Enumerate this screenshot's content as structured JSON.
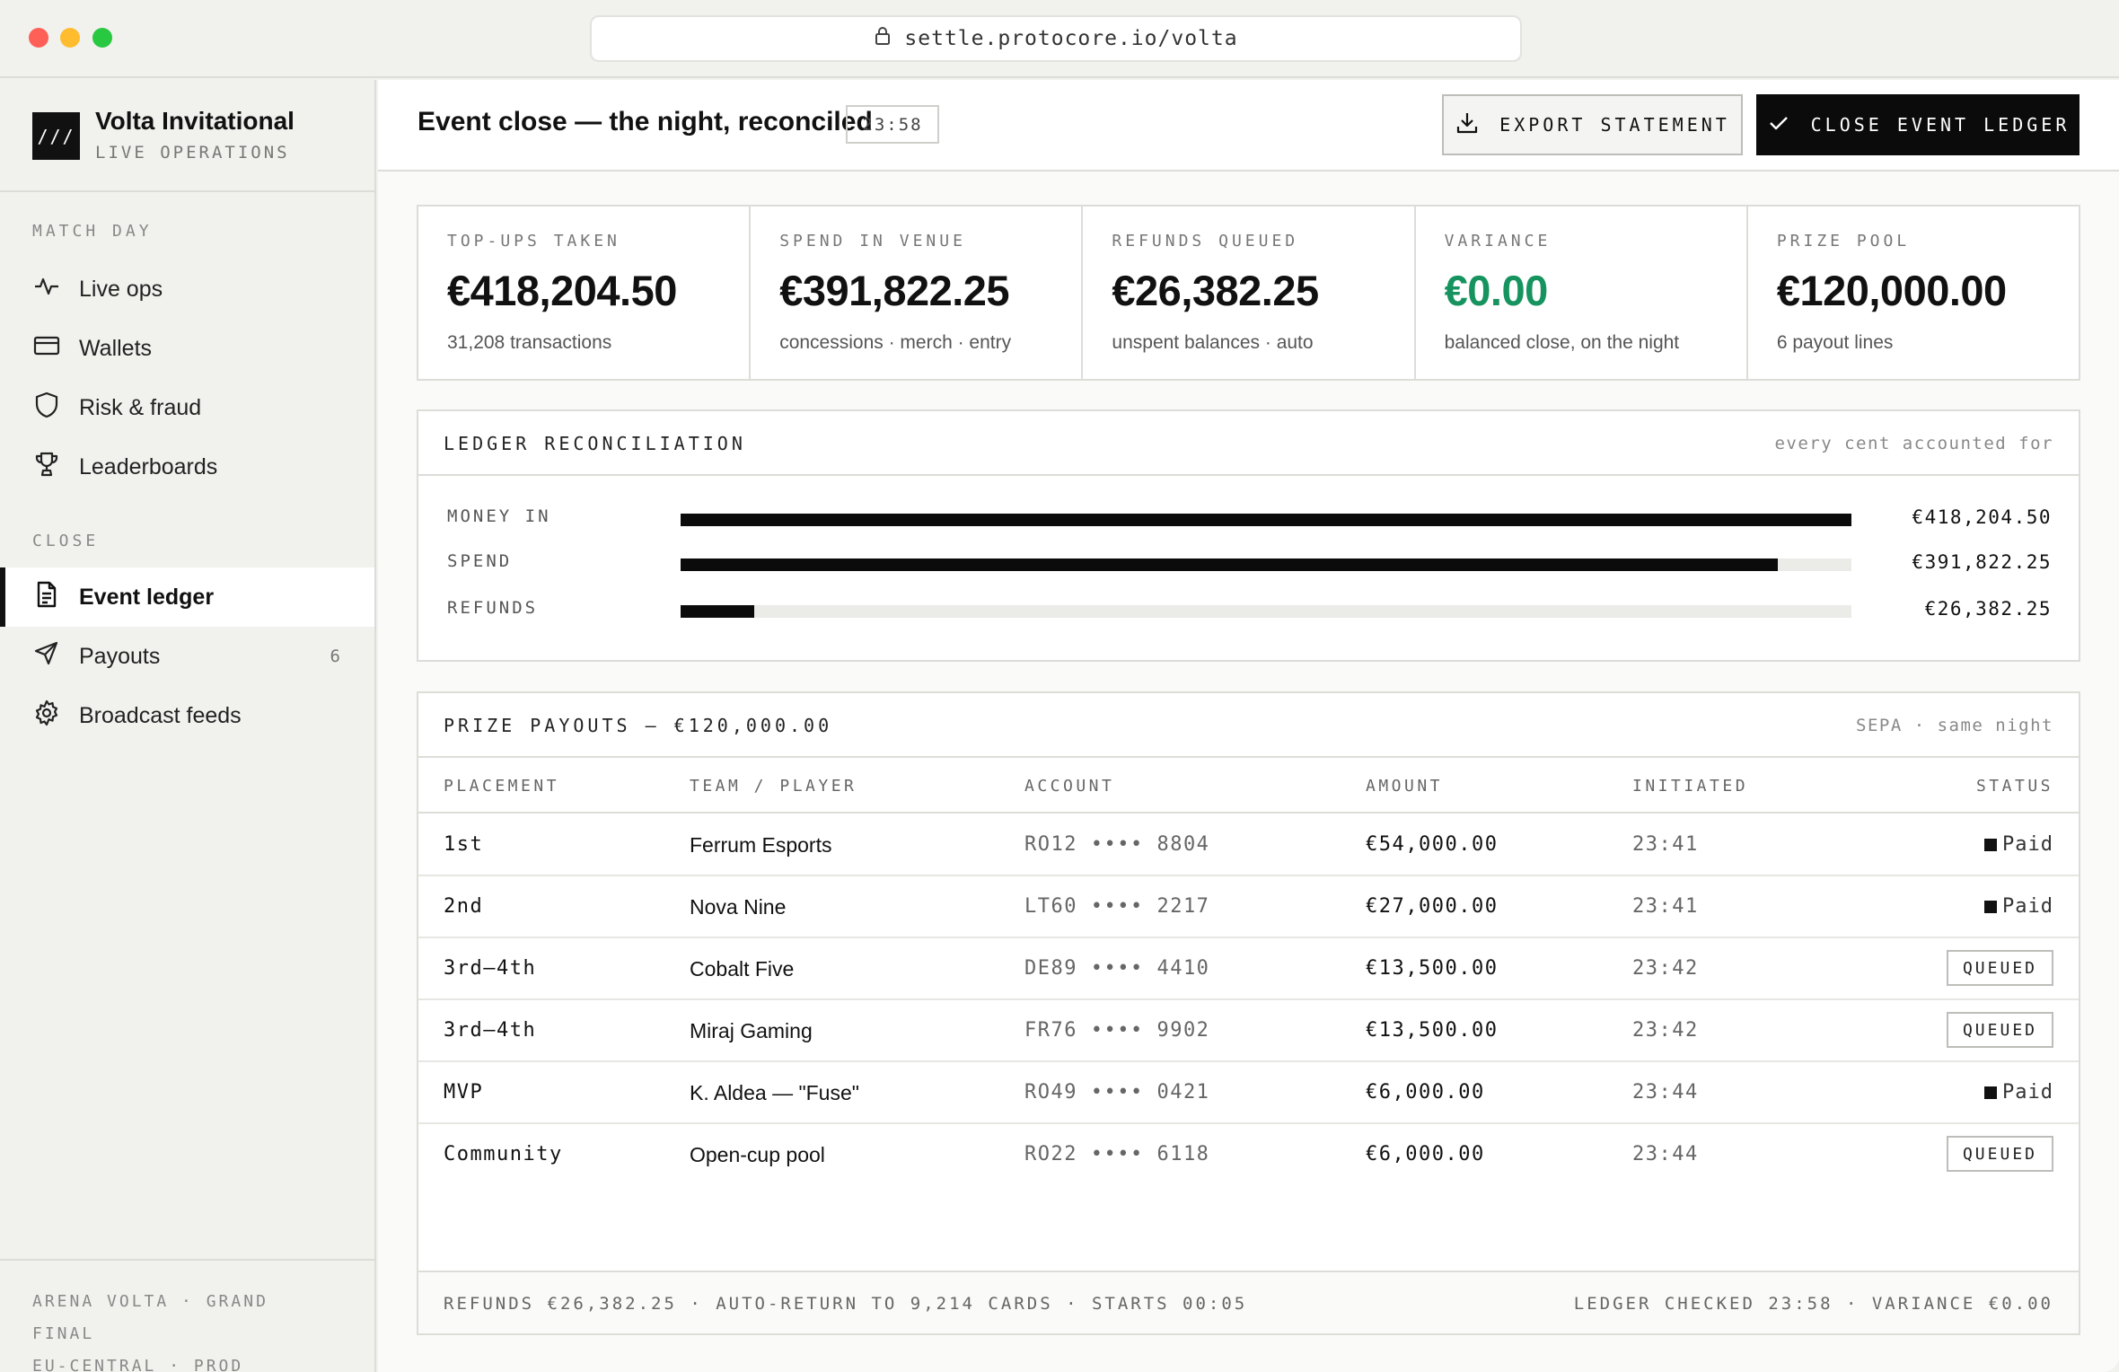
{
  "url": "settle.protocore.io/volta",
  "brand": {
    "logo": "///",
    "name": "Volta Invitational",
    "subtitle": "LIVE OPERATIONS"
  },
  "sidebar": {
    "sections": [
      {
        "label": "MATCH DAY"
      },
      {
        "label": "CLOSE"
      }
    ],
    "items": [
      {
        "label": "Live ops",
        "icon": "pulse-icon"
      },
      {
        "label": "Wallets",
        "icon": "card-icon"
      },
      {
        "label": "Risk & fraud",
        "icon": "shield-icon"
      },
      {
        "label": "Leaderboards",
        "icon": "trophy-icon"
      },
      {
        "label": "Event ledger",
        "icon": "document-icon",
        "active": true
      },
      {
        "label": "Payouts",
        "icon": "send-icon",
        "count": "6"
      },
      {
        "label": "Broadcast feeds",
        "icon": "gear-icon"
      }
    ],
    "footer": {
      "line1": "ARENA VOLTA · GRAND FINAL",
      "line2": "EU-CENTRAL · PROD"
    }
  },
  "header": {
    "title": "Event close — the night, reconciled",
    "clock": "23:58",
    "export_label": "EXPORT STATEMENT",
    "close_label": "CLOSE EVENT LEDGER"
  },
  "stats": [
    {
      "label": "TOP-UPS TAKEN",
      "value": "€418,204.50",
      "note": "31,208 transactions"
    },
    {
      "label": "SPEND IN VENUE",
      "value": "€391,822.25",
      "note": "concessions · merch · entry"
    },
    {
      "label": "REFUNDS QUEUED",
      "value": "€26,382.25",
      "note": "unspent balances · auto"
    },
    {
      "label": "VARIANCE",
      "value": "€0.00",
      "note": "balanced close, on the night"
    },
    {
      "label": "PRIZE POOL",
      "value": "€120,000.00",
      "note": "6 payout lines"
    }
  ],
  "reconciliation": {
    "title": "LEDGER RECONCILIATION",
    "aside": "every cent accounted for",
    "rows": [
      {
        "label": "MONEY IN",
        "amount": "€418,204.50",
        "fill": 1.0
      },
      {
        "label": "SPEND",
        "amount": "€391,822.25",
        "fill": 0.937
      },
      {
        "label": "REFUNDS",
        "amount": "€26,382.25",
        "fill": 0.063
      }
    ]
  },
  "payouts": {
    "title": "PRIZE PAYOUTS — €120,000.00",
    "aside": "SEPA · same night",
    "columns": [
      "PLACEMENT",
      "TEAM / PLAYER",
      "ACCOUNT",
      "AMOUNT",
      "INITIATED",
      "STATUS"
    ],
    "rows": [
      {
        "placement": "1st",
        "team": "Ferrum Esports",
        "account": "RO12 •••• 8804",
        "amount": "€54,000.00",
        "initiated": "23:41",
        "status": "Paid"
      },
      {
        "placement": "2nd",
        "team": "Nova Nine",
        "account": "LT60 •••• 2217",
        "amount": "€27,000.00",
        "initiated": "23:41",
        "status": "Paid"
      },
      {
        "placement": "3rd–4th",
        "team": "Cobalt Five",
        "account": "DE89 •••• 4410",
        "amount": "€13,500.00",
        "initiated": "23:42",
        "status": "QUEUED"
      },
      {
        "placement": "3rd–4th",
        "team": "Miraj Gaming",
        "account": "FR76 •••• 9902",
        "amount": "€13,500.00",
        "initiated": "23:42",
        "status": "QUEUED"
      },
      {
        "placement": "MVP",
        "team": "K. Aldea — \"Fuse\"",
        "account": "RO49 •••• 0421",
        "amount": "€6,000.00",
        "initiated": "23:44",
        "status": "Paid"
      },
      {
        "placement": "Community",
        "team": "Open-cup pool",
        "account": "RO22 •••• 6118",
        "amount": "€6,000.00",
        "initiated": "23:44",
        "status": "QUEUED"
      }
    ],
    "footer_left": "REFUNDS €26,382.25 · AUTO-RETURN TO 9,214 CARDS · STARTS 00:05",
    "footer_right": "LEDGER CHECKED 23:58 · VARIANCE €0.00"
  },
  "colors": {
    "accent": "#0b0b0b",
    "positive": "#16935f",
    "background": "#f1f1ee"
  }
}
